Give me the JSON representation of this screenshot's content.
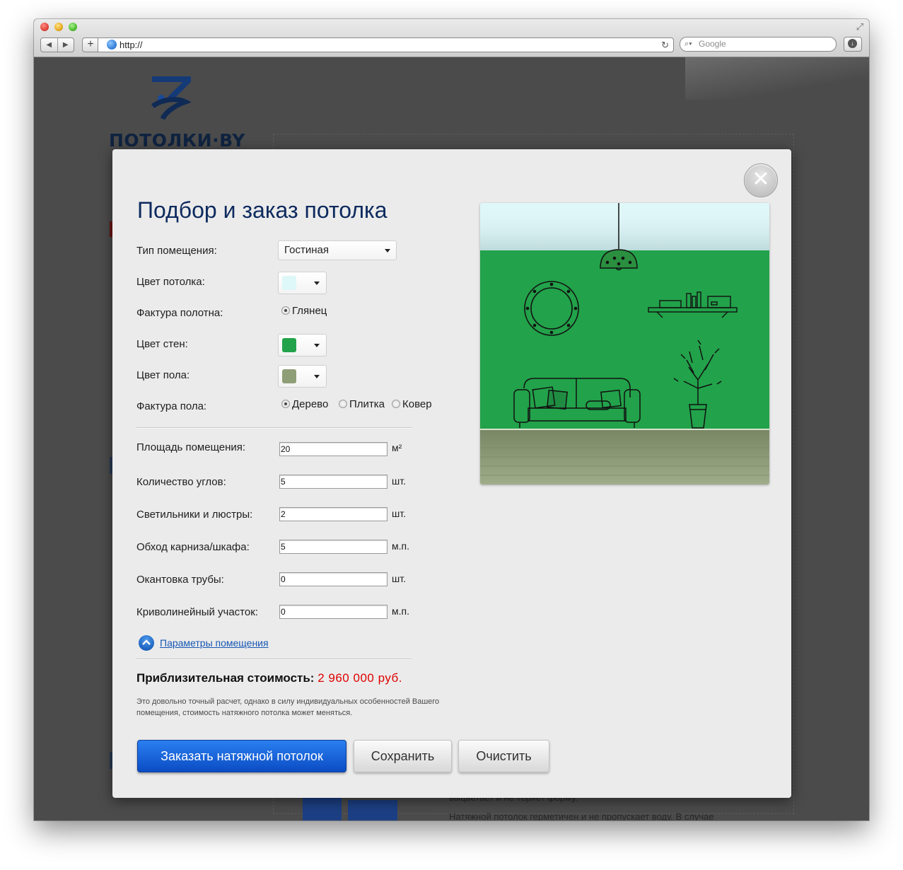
{
  "browser": {
    "url": "http://",
    "search_placeholder": "Google"
  },
  "background": {
    "logo_text": "ПОТОЛКИ·BY",
    "text_line1": "выцветает и не теряет форму.",
    "text_line2": "Натяжной потолок герметичен и не пропускает воду. В случае"
  },
  "modal": {
    "title": "Подбор и заказ потолка",
    "room_type": {
      "label": "Тип помещения:",
      "value": "Гостиная"
    },
    "ceiling_color": {
      "label": "Цвет потолка:",
      "color": "#def7f8"
    },
    "ceiling_texture": {
      "label": "Фактура полотна:",
      "options": [
        "Глянец"
      ],
      "selected": "Глянец"
    },
    "wall_color": {
      "label": "Цвет стен:",
      "color": "#22a24a"
    },
    "floor_color": {
      "label": "Цвет пола:",
      "color": "#8e9e76"
    },
    "floor_texture": {
      "label": "Фактура пола:",
      "options": [
        "Дерево",
        "Плитка",
        "Ковер"
      ],
      "selected": "Дерево"
    },
    "fields": [
      {
        "label": "Площадь помещения:",
        "value": "20",
        "unit": "м²"
      },
      {
        "label": "Количество углов:",
        "value": "5",
        "unit": "шт."
      },
      {
        "label": "Светильники и люстры:",
        "value": "2",
        "unit": "шт."
      },
      {
        "label": "Обход карниза/шкафа:",
        "value": "5",
        "unit": "м.п."
      },
      {
        "label": "Окантовка трубы:",
        "value": "0",
        "unit": "шт."
      },
      {
        "label": "Криволинейный участок:",
        "value": "0",
        "unit": "м.п."
      }
    ],
    "params_link": "Параметры помещения",
    "cost_label": "Приблизительная стоимость:",
    "cost_value": "2 960 000 руб.",
    "note": "Это довольно точный расчет, однако в силу индивидуальных особенностей Вашего помещения, стоимость натяжного потолка может меняться.",
    "buttons": {
      "order": "Заказать натяжной потолок",
      "save": "Сохранить",
      "clear": "Очистить"
    }
  },
  "icons": [
    "close-icon",
    "globe-icon",
    "reload-icon",
    "search-icon",
    "download-icon",
    "chevron-up-icon",
    "dropdown-arrow-icon"
  ]
}
